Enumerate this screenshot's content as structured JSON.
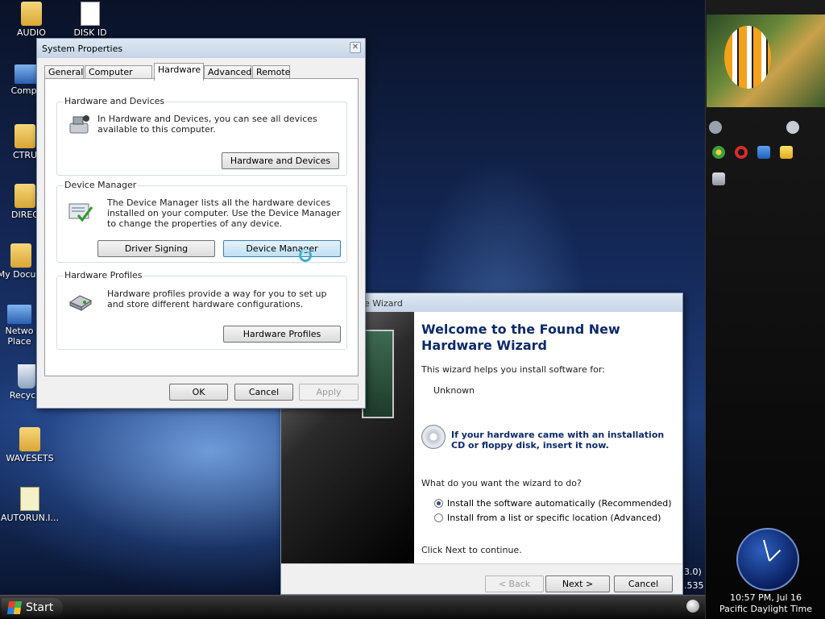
{
  "desktop": {
    "icons": [
      {
        "label": "AUDIO",
        "kind": "folder"
      },
      {
        "label": "DISK ID",
        "kind": "file"
      },
      {
        "label": "Compu",
        "kind": "computer"
      },
      {
        "label": "CTRU",
        "kind": "folder"
      },
      {
        "label": "DIREC",
        "kind": "folder"
      },
      {
        "label": "My Docum",
        "kind": "documents"
      },
      {
        "label": "Netwo Place",
        "kind": "network"
      },
      {
        "label": "Recycle",
        "kind": "recycle-bin"
      },
      {
        "label": "WAVESETS",
        "kind": "folder"
      },
      {
        "label": "AUTORUN.I...",
        "kind": "script"
      }
    ],
    "behind_text_1": "3.0)",
    "behind_text_2": ".535"
  },
  "system_properties": {
    "title": "System Properties",
    "close_glyph": "✕",
    "tabs": [
      "General",
      "Computer Name",
      "Hardware",
      "Advanced",
      "Remote"
    ],
    "active_tab": "Hardware",
    "hardware_devices": {
      "title": "Hardware and Devices",
      "text": "In Hardware and Devices, you can see all devices available to this computer.",
      "button": "Hardware and Devices"
    },
    "device_manager": {
      "title": "Device Manager",
      "text": "The Device Manager lists all the hardware devices installed on your computer. Use the Device Manager to change the properties of any device.",
      "driver_signing_button": "Driver Signing",
      "device_manager_button": "Device Manager"
    },
    "hardware_profiles": {
      "title": "Hardware Profiles",
      "text": "Hardware profiles provide a way for you to set up and store different hardware configurations.",
      "button": "Hardware Profiles"
    },
    "ok": "OK",
    "cancel": "Cancel",
    "apply": "Apply"
  },
  "wizard": {
    "title": "are Wizard",
    "heading": "Welcome to the Found New Hardware Wizard",
    "intro": "This wizard helps you install software for:",
    "device": "Unknown",
    "cd_prompt": "If your hardware came with an installation CD or floppy disk, insert it now.",
    "question": "What do you want the wizard to do?",
    "option_auto": "Install the software automatically (Recommended)",
    "option_manual": "Install from a list or specific location (Advanced)",
    "selected_option": "option_auto",
    "continue_text": "Click Next to continue.",
    "back": "< Back",
    "next": "Next >",
    "cancel": "Cancel"
  },
  "taskbar": {
    "start_label": "Start"
  },
  "sidebar": {
    "time": "10:57 PM, Jul 16",
    "timezone": "Pacific Daylight Time"
  },
  "colors": {
    "wizard_heading": "#0c2a6a",
    "focus_button": "#3c7fb1"
  }
}
